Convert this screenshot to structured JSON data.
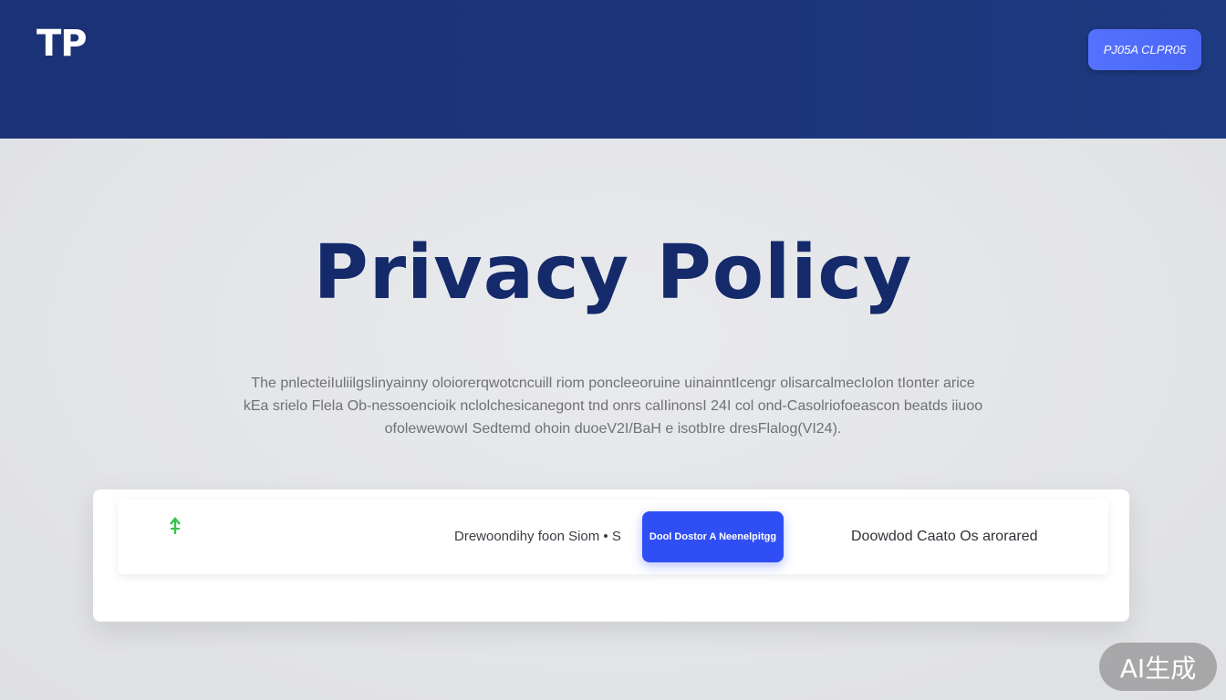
{
  "header": {
    "logo_text": "TP",
    "action_button_label": "PJ05A CLPR05",
    "background_color": "#1c347a"
  },
  "main": {
    "title": "Privacy Policy",
    "intro_lines": [
      "The pnlecteiIuliilgslinyainny oloiorerqwotcncuill riom poncleeoruine uinainntIcengr olisarcalmecIoIon tIonter arice",
      "kEa srielo Flela Ob-nessoencioik nclolchesicanegont  tnd onrs calIinonsI 24I col ond-Casolriofoeascon beatds iiuoo",
      "ofolewewowI Sedtemd ohoin duoeV2I/BaH e isotbIre dresFlalog(VI24)."
    ]
  },
  "download_card": {
    "icon": "download-arrow-icon",
    "link_1": "Drewoondihy foon Siom • S",
    "button_label": "Dool Dostor A Neenelpitgg",
    "link_2": "Doowdod Caato Os arorared",
    "accent_color": "#2f4ff5",
    "icon_color": "#34c44a"
  },
  "watermark": {
    "text": "AI生成"
  }
}
